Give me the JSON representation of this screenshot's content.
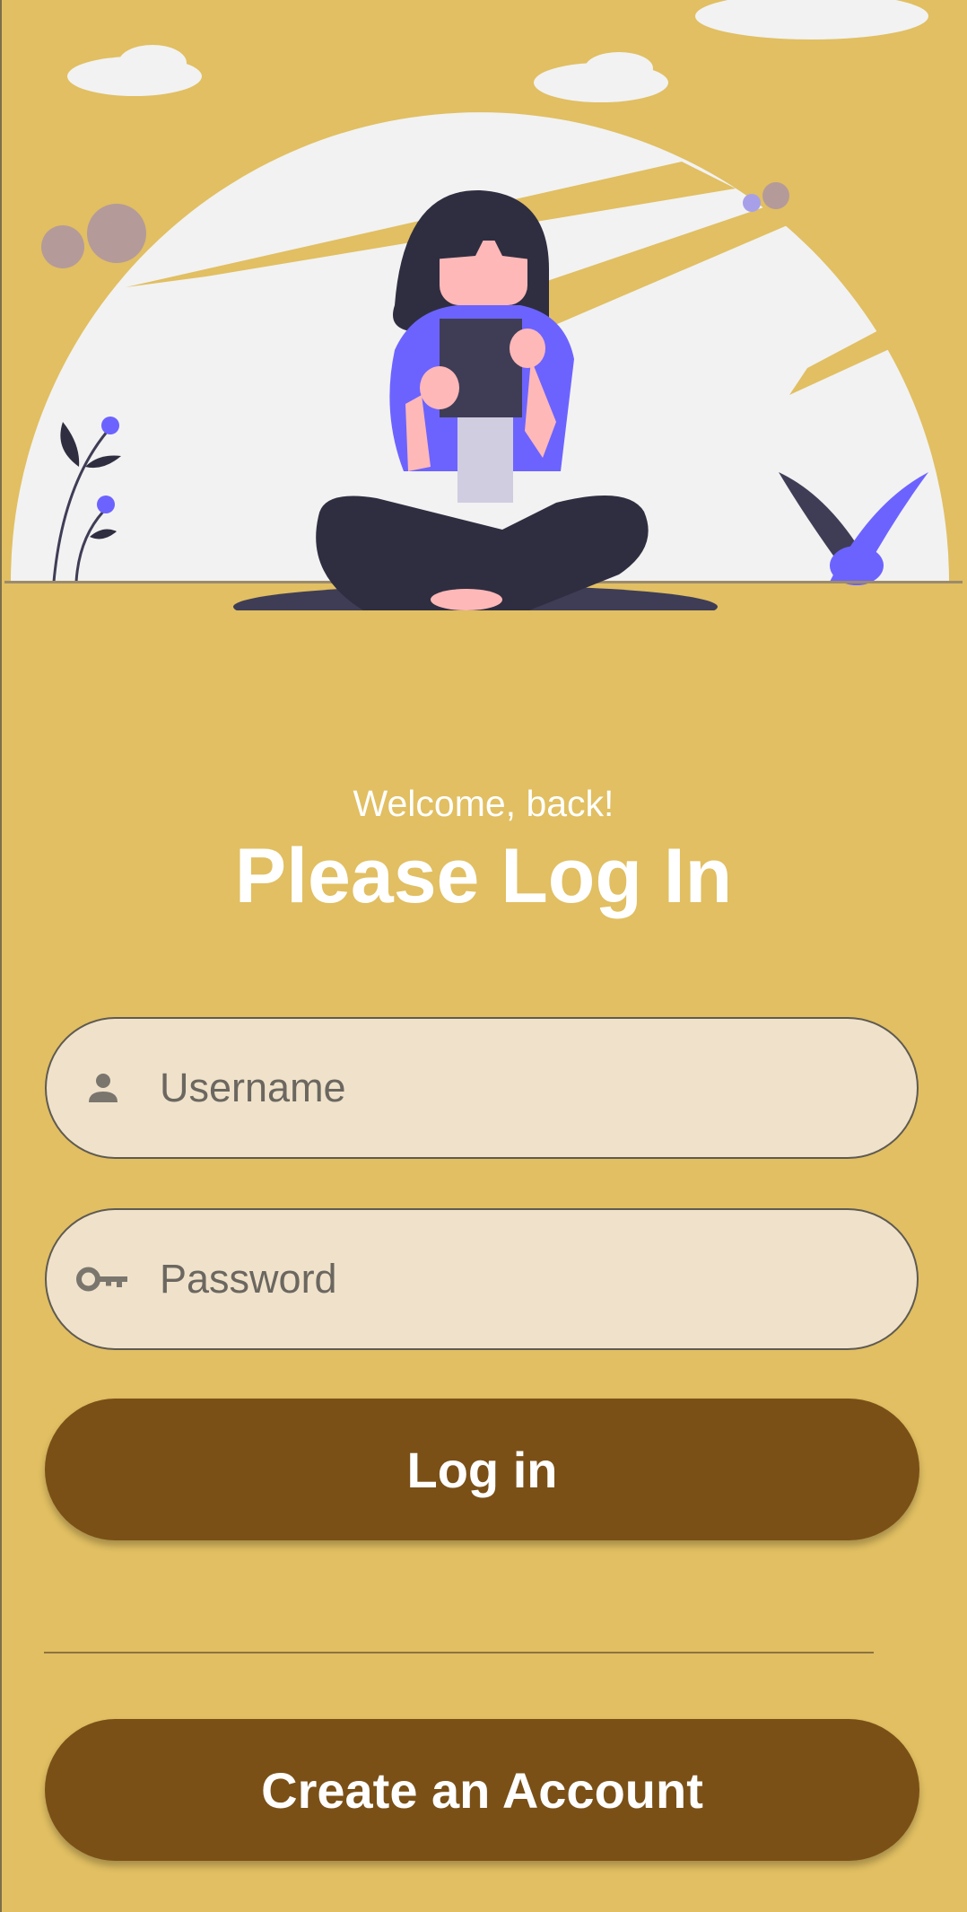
{
  "header": {
    "greeting": "Welcome, back!",
    "title": "Please Log In"
  },
  "form": {
    "username": {
      "placeholder": "Username",
      "value": "",
      "icon": "person-icon"
    },
    "password": {
      "placeholder": "Password",
      "value": "",
      "icon": "key-icon"
    },
    "login_label": "Log in",
    "create_account_label": "Create an Account"
  },
  "colors": {
    "background": "#E1BF62",
    "field_fill": "#F0E2CA",
    "button": "#7A5017",
    "illustration_accent": "#6C63FF",
    "illustration_dark": "#2F2E41"
  }
}
